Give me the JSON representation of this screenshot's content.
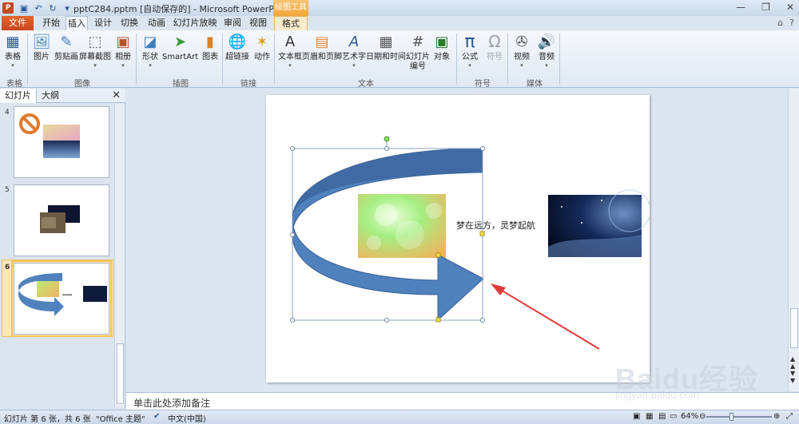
{
  "titlebar": {
    "app_icon": "P",
    "title": "pptC284.pptm [自动保存的] - Microsoft PowerPoint",
    "context_header": "绘图工具",
    "qat_icons": [
      "save-icon",
      "undo-icon",
      "redo-icon",
      "customize-icon"
    ]
  },
  "tabs": {
    "file": "文件",
    "items": [
      "开始",
      "插入",
      "设计",
      "切换",
      "动画",
      "幻灯片放映",
      "审阅",
      "视图"
    ],
    "context": "格式",
    "active": "插入"
  },
  "ribbon": {
    "buttons": {
      "table": "表格",
      "picture": "图片",
      "clipart": "剪贴画",
      "screenshot": "屏幕截图",
      "album": "相册",
      "shapes": "形状",
      "smartart": "SmartArt",
      "chart": "图表",
      "hyperlink": "超链接",
      "action": "动作",
      "textbox": "文本框",
      "header_footer": "页眉和页脚",
      "wordart": "艺术字",
      "datetime": "日期和时间",
      "slide_number": "幻灯片\n编号",
      "object": "对象",
      "equation": "公式",
      "symbol": "符号",
      "video": "视频",
      "audio": "音频"
    },
    "groups": {
      "tables": "表格",
      "images": "图像",
      "illustrations": "插图",
      "links": "链接",
      "text": "文本",
      "symbols": "符号",
      "media": "媒体"
    }
  },
  "left_panel": {
    "tab_slides": "幻灯片",
    "tab_outline": "大纲",
    "thumbnails": [
      {
        "number": "4"
      },
      {
        "number": "5"
      },
      {
        "number": "6",
        "selected": true
      }
    ]
  },
  "slide": {
    "caption": "梦在远方，灵梦起航"
  },
  "notes": {
    "placeholder": "单击此处添加备注"
  },
  "status": {
    "slide_info": "幻灯片 第 6 张，共 6 张",
    "theme": "\"Office 主题\"",
    "language": "中文(中国)",
    "zoom": "64%",
    "zoom_fraction": 0.64
  },
  "watermark": {
    "brand": "Baidu经验",
    "url": "jingyan.baidu.com"
  },
  "colors": {
    "arrow_fill": "#4f81bd",
    "arrow_dark": "#3a6196",
    "red_annotation": "#e23b3b",
    "file_tab": "#c8471f",
    "context_tab": "#f2a53a"
  }
}
